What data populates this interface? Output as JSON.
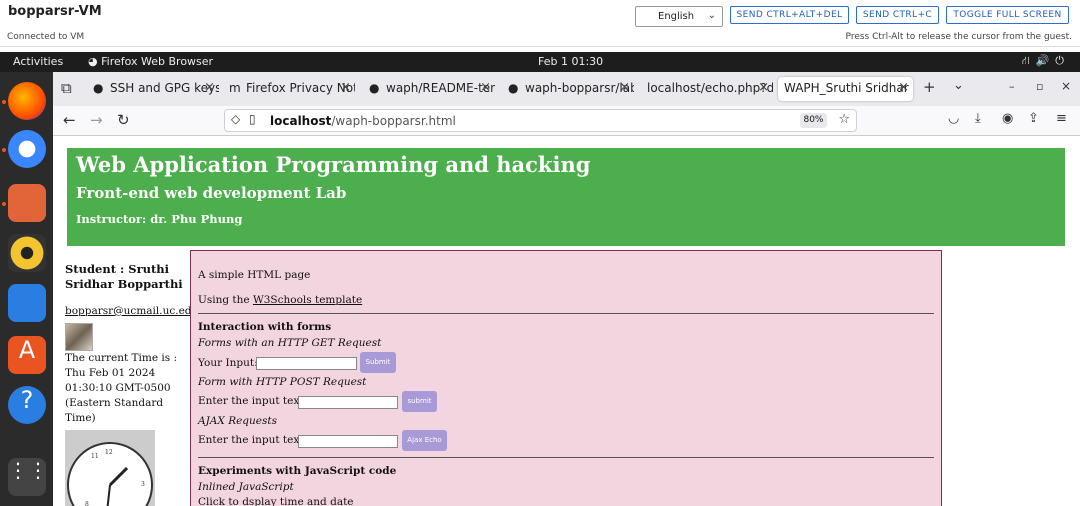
{
  "vm": {
    "title": "bopparsr-VM",
    "status": "Connected to VM",
    "language": "English",
    "buttons": [
      "SEND CTRL+ALT+DEL",
      "SEND CTRL+C",
      "TOGGLE FULL SCREEN"
    ],
    "hint": "Press Ctrl-Alt to release the cursor from the guest."
  },
  "topbar": {
    "activities": "Activities",
    "app": "Firefox Web Browser",
    "clock": "Feb 1  01:30"
  },
  "browser": {
    "tabs": [
      {
        "label": "SSH and GPG keys",
        "icon": "github-icon"
      },
      {
        "label": "Firefox Privacy Not",
        "icon": "mozilla-icon"
      },
      {
        "label": "waph/README-ten",
        "icon": "github-icon"
      },
      {
        "label": "waph-bopparsr/lab",
        "icon": "github-icon"
      },
      {
        "label": "localhost/echo.php?da",
        "icon": "none"
      },
      {
        "label": "WAPH_Sruthi Sridhar",
        "icon": "none"
      }
    ],
    "url_host": "localhost",
    "url_path": "/waph-bopparsr.html",
    "zoom": "80%"
  },
  "page": {
    "heading": "Web Application Programming and hacking",
    "subheading": "Front-end web development Lab",
    "instructor": "Instructor: dr. Phu Phung",
    "student": "Student : Sruthi Sridhar Bopparthi",
    "email": "bopparsr@ucmail.uc.edu",
    "time_lines": [
      "The current Time is :",
      "Thu Feb 01 2024",
      "01:30:10 GMT-0500",
      "(Eastern Standard",
      "Time)"
    ],
    "simple": "A simple HTML page",
    "using": "Using the ",
    "w3": "W3Schools template",
    "forms_title": "Interaction with forms",
    "get_title": "Forms with an HTTP GET Request",
    "your_input": "Your Input:",
    "submit1": "Submit",
    "post_title": "Form with HTTP POST Request",
    "enter_text": "Enter the input text",
    "submit2": "submit",
    "ajax_title": "AJAX Requests",
    "enter_text2": "Enter the input text",
    "ajax_btn": "Ajax Echo",
    "js_title": "Experiments with JavaScript code",
    "inline": "Inlined JavaScript",
    "click": "Click to dsplay time and date"
  }
}
